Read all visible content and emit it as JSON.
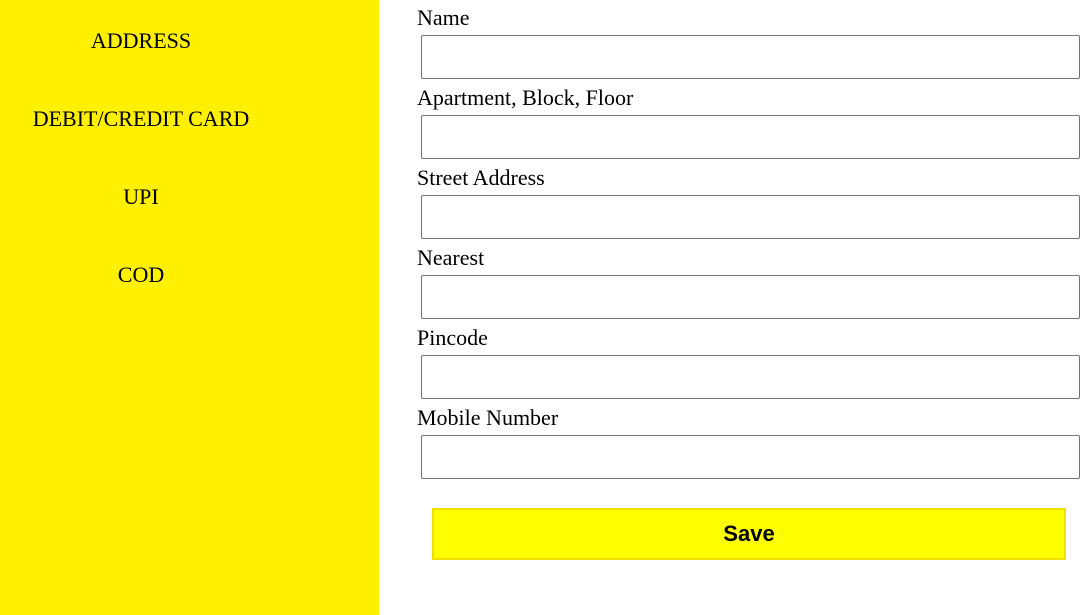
{
  "sidebar": {
    "background": "#fff000",
    "items": [
      {
        "label": "ADDRESS"
      },
      {
        "label": "DEBIT/CREDIT CARD"
      },
      {
        "label": "UPI"
      },
      {
        "label": "COD"
      }
    ]
  },
  "form": {
    "fields": [
      {
        "label": "Name",
        "value": "",
        "placeholder": ""
      },
      {
        "label": "Apartment, Block, Floor",
        "value": "",
        "placeholder": ""
      },
      {
        "label": "Street Address",
        "value": "",
        "placeholder": ""
      },
      {
        "label": "Nearest",
        "value": "",
        "placeholder": ""
      },
      {
        "label": "Pincode",
        "value": "",
        "placeholder": ""
      },
      {
        "label": "Mobile Number",
        "value": "",
        "placeholder": ""
      }
    ],
    "save_label": "Save",
    "save_color": "#ffff00"
  }
}
